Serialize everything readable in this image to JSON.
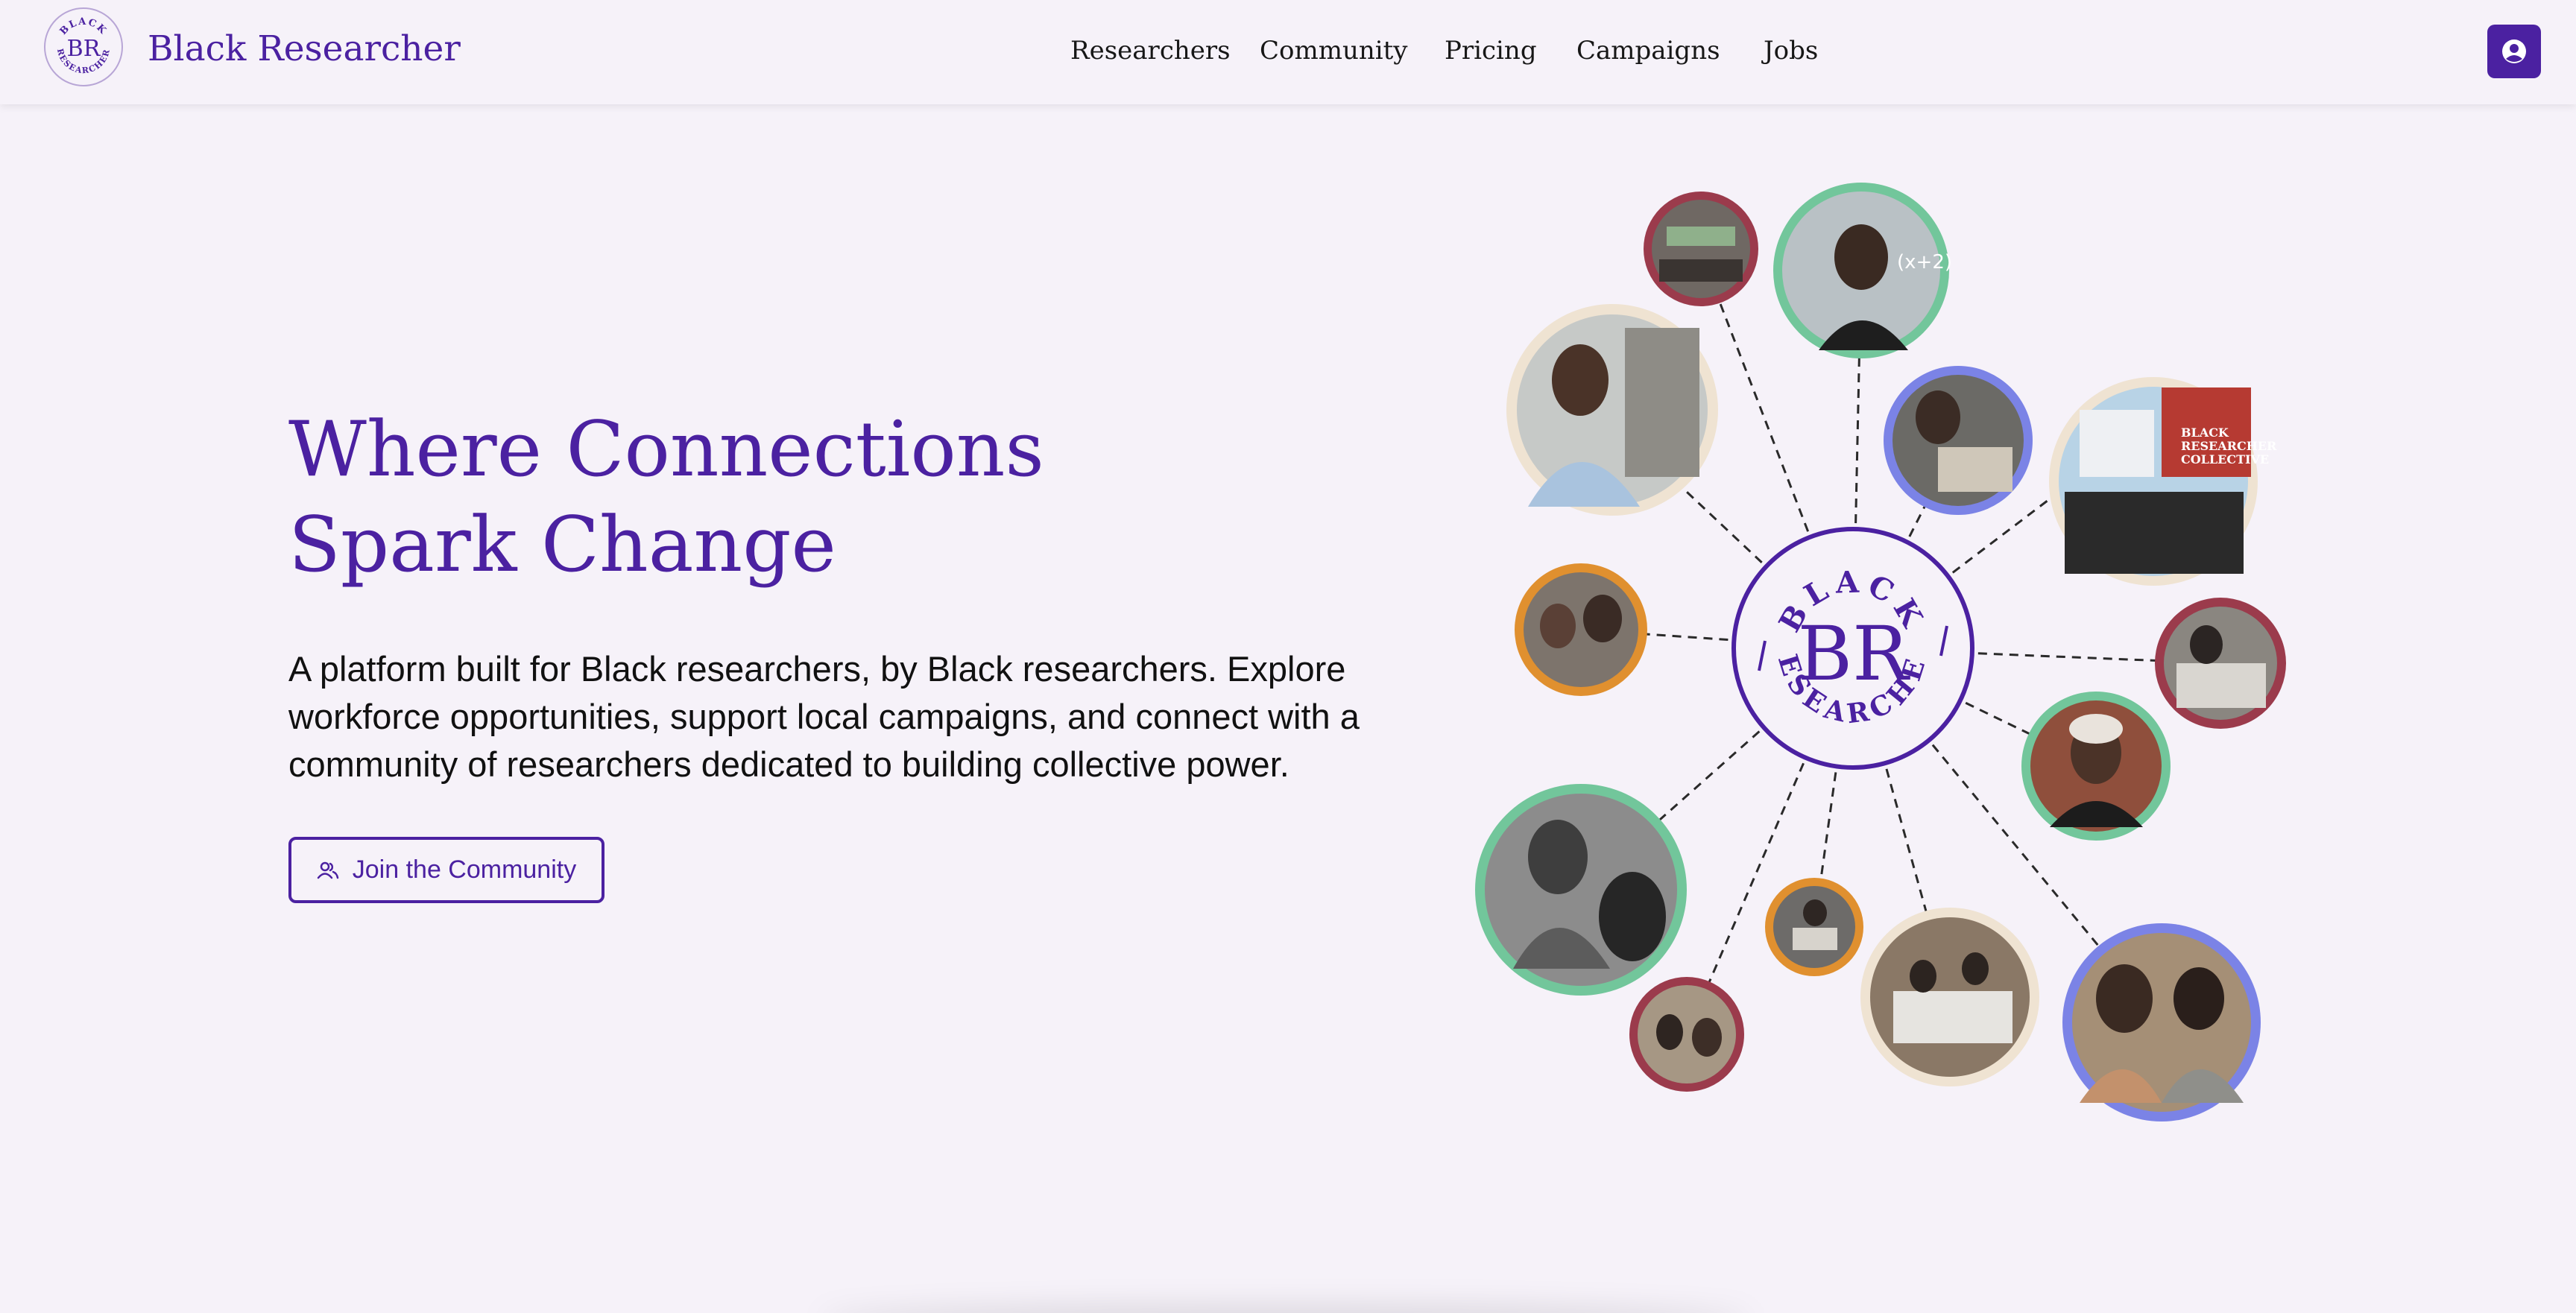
{
  "header": {
    "brand_name": "Black Researcher",
    "logo": {
      "top_text": "BLACK",
      "initials": "BR",
      "bottom_text": "RESEARCHER"
    },
    "nav": [
      {
        "label": "Researchers"
      },
      {
        "label": "Community"
      },
      {
        "label": "Pricing"
      },
      {
        "label": "Campaigns"
      },
      {
        "label": "Jobs"
      }
    ],
    "account_icon": "user-circle-icon"
  },
  "hero": {
    "title_lines": [
      "Where Connections",
      "Spark Change"
    ],
    "description_lines": [
      "A platform built for Black researchers, by Black researchers. Explore",
      "workforce opportunities, support local campaigns, and connect with a",
      "community of researchers dedicated to building collective power."
    ],
    "cta": {
      "label": "Join the Community",
      "icon": "users-icon"
    }
  },
  "network_graphic": {
    "center_emblem": {
      "top_text": "BLACK",
      "initials": "BR",
      "bottom_text": "RESEARCHER"
    },
    "photo_poster_text": [
      "BLACK",
      "RESEARCHER",
      "COLLECTIVE"
    ],
    "ring_colors": {
      "maroon": "#9b3b4c",
      "green": "#72c69b",
      "blue": "#7b83e6",
      "cream": "#efe3d2",
      "orange": "#e0902f"
    }
  },
  "colors": {
    "brand_purple": "#4b21a1",
    "background": "#f6f2f9",
    "text_dark": "#111111"
  }
}
